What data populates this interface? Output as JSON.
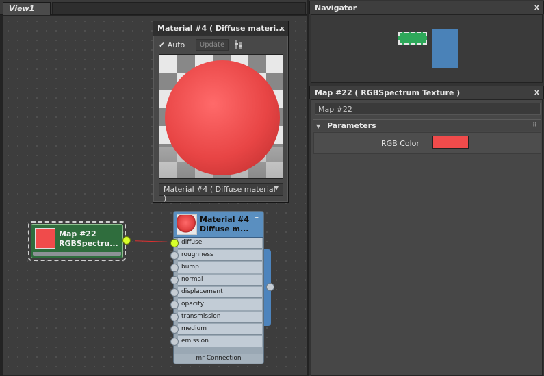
{
  "view": {
    "tab_label": "View1"
  },
  "preview": {
    "title": "Material #4  ( Diffuse materi...",
    "close": "x",
    "auto_label": "Auto",
    "update_label": "Update",
    "selected_material": "Material #4  ( Diffuse material )"
  },
  "map_node": {
    "line1": "Map #22",
    "line2": "RGBSpectru..."
  },
  "material_node": {
    "line1": "Material #4",
    "line2": "Diffuse  m...",
    "collapse": "–",
    "slots": [
      "diffuse",
      "roughness",
      "bump",
      "normal",
      "displacement",
      "opacity",
      "transmission",
      "medium",
      "emission"
    ],
    "footer": "mr Connection"
  },
  "navigator": {
    "title": "Navigator",
    "close": "x"
  },
  "params_panel": {
    "title": "Map #22  ( RGBSpectrum Texture )",
    "close": "x",
    "name_value": "Map #22",
    "rollout_title": "Parameters",
    "rgb_label": "RGB Color",
    "rgb_color": "#f04b4b"
  },
  "colors": {
    "map_node": "#2f6d3d",
    "material_header": "#5a8fc0",
    "connector_active": "#d8ff2a",
    "wire": "#e03030"
  },
  "icons": [
    "check-icon",
    "options-icon",
    "dropdown-arrow-icon",
    "collapse-icon",
    "expand-arrow-icon",
    "grip-icon",
    "close-icon"
  ]
}
